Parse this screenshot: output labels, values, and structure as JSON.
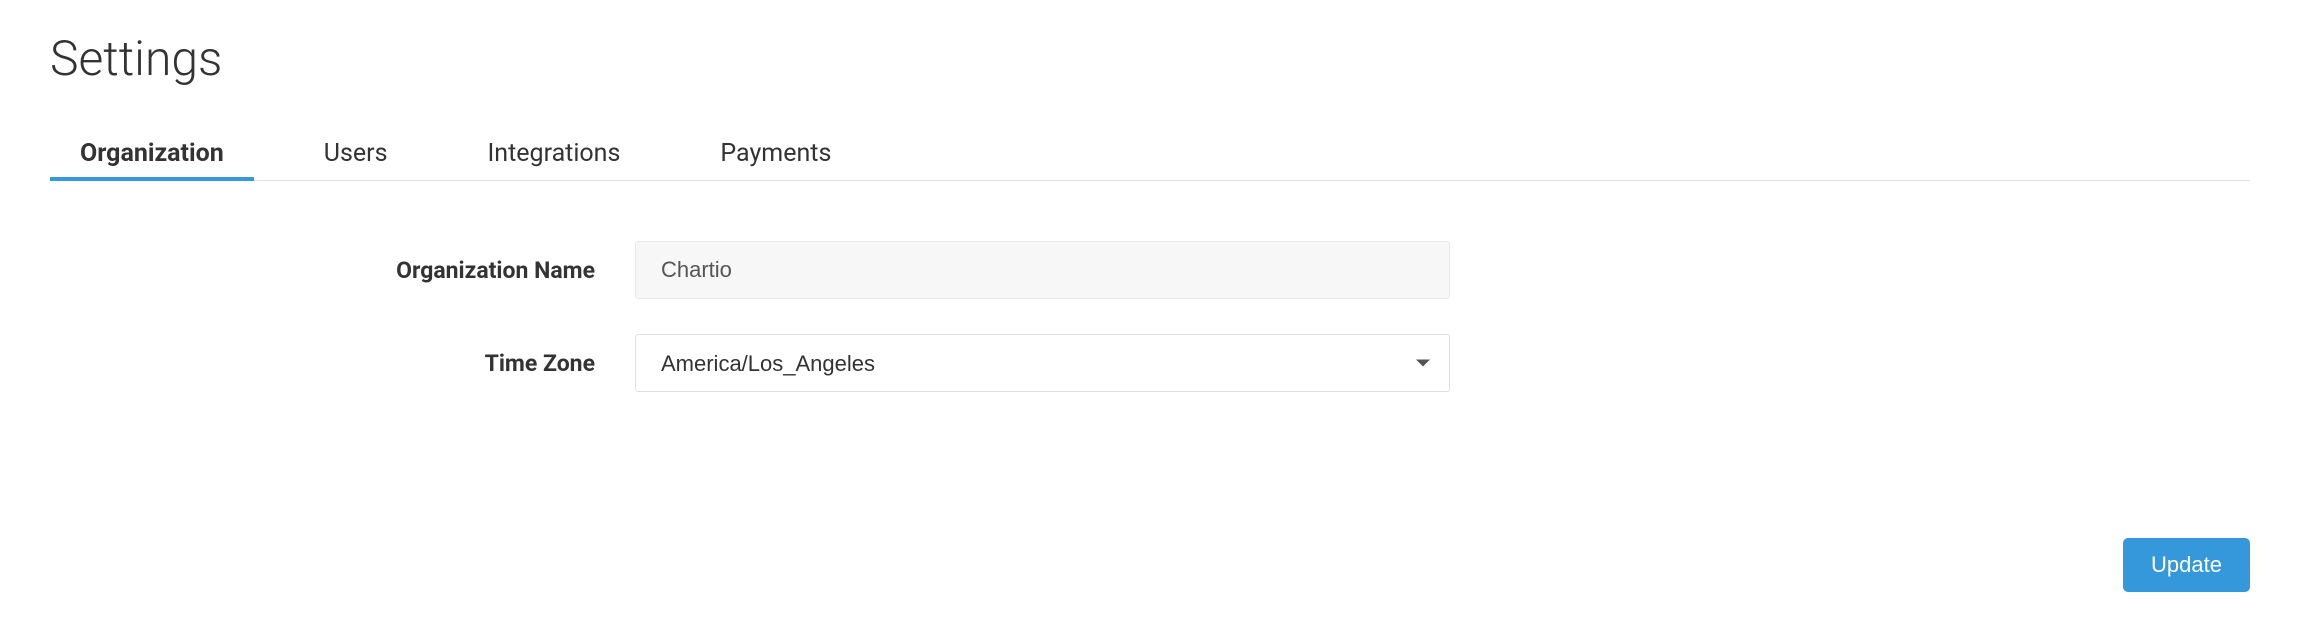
{
  "page": {
    "title": "Settings"
  },
  "tabs": {
    "organization": "Organization",
    "users": "Users",
    "integrations": "Integrations",
    "payments": "Payments"
  },
  "form": {
    "org_name_label": "Organization Name",
    "org_name_value": "Chartio",
    "timezone_label": "Time Zone",
    "timezone_value": "America/Los_Angeles"
  },
  "buttons": {
    "update": "Update"
  }
}
